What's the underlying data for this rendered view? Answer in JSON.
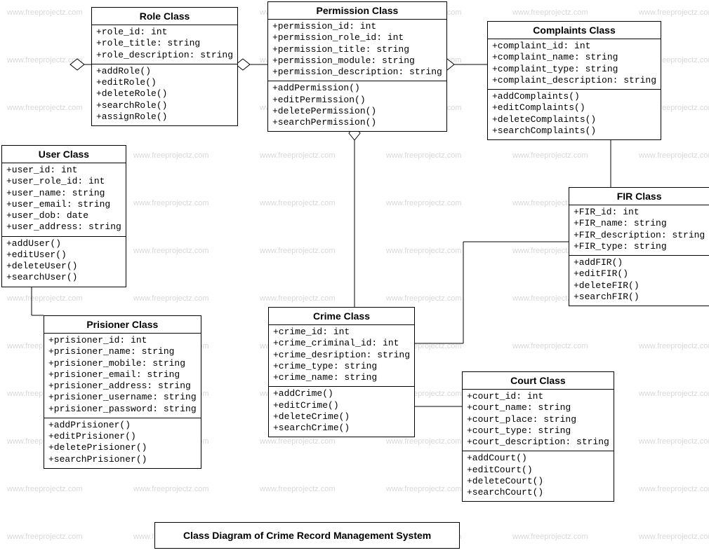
{
  "caption": "Class Diagram of Crime Record Management System",
  "watermark_text": "www.freeprojectz.com",
  "classes": {
    "role": {
      "title": "Role Class",
      "attrs": [
        "+role_id: int",
        "+role_title: string",
        "+role_description: string"
      ],
      "ops": [
        "+addRole()",
        "+editRole()",
        "+deleteRole()",
        "+searchRole()",
        "+assignRole()"
      ]
    },
    "permission": {
      "title": "Permission Class",
      "attrs": [
        "+permission_id: int",
        "+permission_role_id: int",
        "+permission_title: string",
        "+permission_module: string",
        "+permission_description: string"
      ],
      "ops": [
        "+addPermission()",
        "+editPermission()",
        "+deletePermission()",
        "+searchPermission()"
      ]
    },
    "complaints": {
      "title": "Complaints Class",
      "attrs": [
        "+complaint_id: int",
        "+complaint_name: string",
        "+complaint_type: string",
        "+complaint_description: string"
      ],
      "ops": [
        "+addComplaints()",
        "+editComplaints()",
        "+deleteComplaints()",
        "+searchComplaints()"
      ]
    },
    "user": {
      "title": "User Class",
      "attrs": [
        "+user_id: int",
        "+user_role_id: int",
        "+user_name: string",
        "+user_email: string",
        "+user_dob: date",
        "+user_address: string"
      ],
      "ops": [
        "+addUser()",
        "+editUser()",
        "+deleteUser()",
        "+searchUser()"
      ]
    },
    "fir": {
      "title": "FIR Class",
      "attrs": [
        "+FIR_id: int",
        "+FIR_name: string",
        "+FIR_description: string",
        "+FIR_type: string"
      ],
      "ops": [
        "+addFIR()",
        "+editFIR()",
        "+deleteFIR()",
        "+searchFIR()"
      ]
    },
    "prisioner": {
      "title": "Prisioner Class",
      "attrs": [
        "+prisioner_id: int",
        "+prisioner_name: string",
        "+prisioner_mobile: string",
        "+prisioner_email: string",
        "+prisioner_address: string",
        "+prisioner_username: string",
        "+prisioner_password: string"
      ],
      "ops": [
        "+addPrisioner()",
        "+editPrisioner()",
        "+deletePrisioner()",
        "+searchPrisioner()"
      ]
    },
    "crime": {
      "title": "Crime Class",
      "attrs": [
        "+crime_id: int",
        "+crime_criminal_id: int",
        "+crime_desription: string",
        "+crime_type: string",
        "+crime_name: string"
      ],
      "ops": [
        "+addCrime()",
        "+editCrime()",
        "+deleteCrime()",
        "+searchCrime()"
      ]
    },
    "court": {
      "title": "Court Class",
      "attrs": [
        "+court_id: int",
        "+court_name: string",
        "+court_place: string",
        "+court_type: string",
        "+court_description: string"
      ],
      "ops": [
        "+addCourt()",
        "+editCourt()",
        "+deleteCourt()",
        "+searchCourt()"
      ]
    }
  },
  "chart_data": {
    "type": "uml-class-diagram",
    "title": "Class Diagram of Crime Record Management System",
    "classes": [
      {
        "name": "Role",
        "attributes": [
          "role_id:int",
          "role_title:string",
          "role_description:string"
        ],
        "operations": [
          "addRole",
          "editRole",
          "deleteRole",
          "searchRole",
          "assignRole"
        ]
      },
      {
        "name": "Permission",
        "attributes": [
          "permission_id:int",
          "permission_role_id:int",
          "permission_title:string",
          "permission_module:string",
          "permission_description:string"
        ],
        "operations": [
          "addPermission",
          "editPermission",
          "deletePermission",
          "searchPermission"
        ]
      },
      {
        "name": "Complaints",
        "attributes": [
          "complaint_id:int",
          "complaint_name:string",
          "complaint_type:string",
          "complaint_description:string"
        ],
        "operations": [
          "addComplaints",
          "editComplaints",
          "deleteComplaints",
          "searchComplaints"
        ]
      },
      {
        "name": "User",
        "attributes": [
          "user_id:int",
          "user_role_id:int",
          "user_name:string",
          "user_email:string",
          "user_dob:date",
          "user_address:string"
        ],
        "operations": [
          "addUser",
          "editUser",
          "deleteUser",
          "searchUser"
        ]
      },
      {
        "name": "FIR",
        "attributes": [
          "FIR_id:int",
          "FIR_name:string",
          "FIR_description:string",
          "FIR_type:string"
        ],
        "operations": [
          "addFIR",
          "editFIR",
          "deleteFIR",
          "searchFIR"
        ]
      },
      {
        "name": "Prisioner",
        "attributes": [
          "prisioner_id:int",
          "prisioner_name:string",
          "prisioner_mobile:string",
          "prisioner_email:string",
          "prisioner_address:string",
          "prisioner_username:string",
          "prisioner_password:string"
        ],
        "operations": [
          "addPrisioner",
          "editPrisioner",
          "deletePrisioner",
          "searchPrisioner"
        ]
      },
      {
        "name": "Crime",
        "attributes": [
          "crime_id:int",
          "crime_criminal_id:int",
          "crime_desription:string",
          "crime_type:string",
          "crime_name:string"
        ],
        "operations": [
          "addCrime",
          "editCrime",
          "deleteCrime",
          "searchCrime"
        ]
      },
      {
        "name": "Court",
        "attributes": [
          "court_id:int",
          "court_name:string",
          "court_place:string",
          "court_type:string",
          "court_description:string"
        ],
        "operations": [
          "addCourt",
          "editCourt",
          "deleteCourt",
          "searchCourt"
        ]
      }
    ],
    "relationships": [
      {
        "type": "aggregation",
        "owner": "User",
        "part": "Role"
      },
      {
        "type": "aggregation",
        "owner": "Role",
        "part": "Permission"
      },
      {
        "type": "aggregation",
        "owner": "Permission",
        "part": "Complaints"
      },
      {
        "type": "aggregation",
        "owner": "Permission",
        "part": "Crime"
      },
      {
        "type": "association",
        "from": "User",
        "to": "Prisioner"
      },
      {
        "type": "association",
        "from": "Complaints",
        "to": "FIR"
      },
      {
        "type": "association",
        "from": "Crime",
        "to": "FIR"
      },
      {
        "type": "association",
        "from": "Crime",
        "to": "Court"
      }
    ]
  }
}
